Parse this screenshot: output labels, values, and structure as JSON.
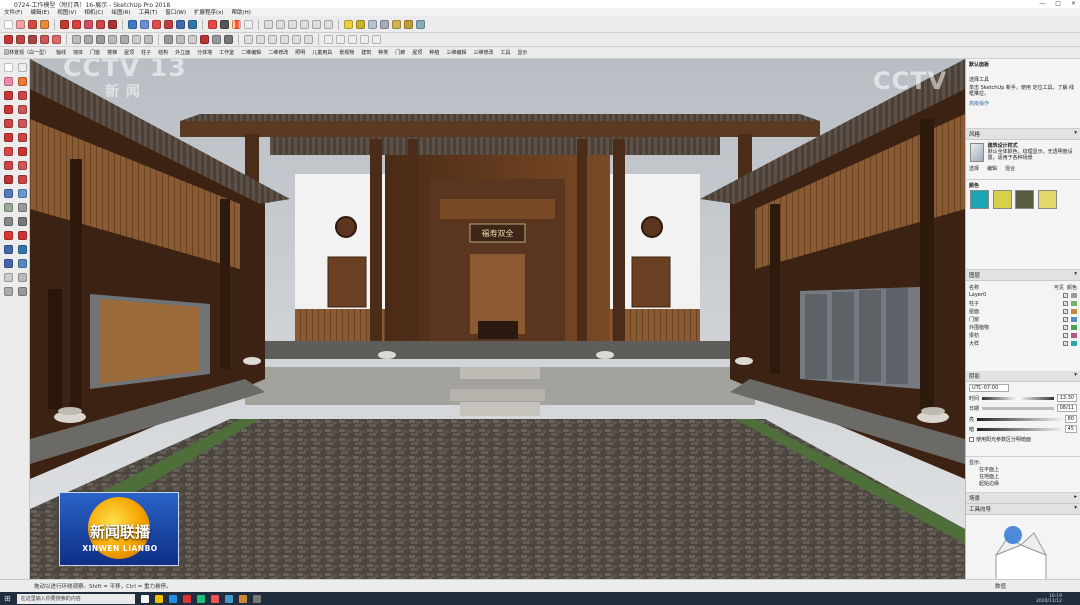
{
  "window": {
    "title": "0724-工作模型（附灯具）16-展示 - SketchUp Pro 2018",
    "controls": [
      "—",
      "□",
      "×"
    ]
  },
  "menu": [
    "文件(F)",
    "编辑(E)",
    "视图(V)",
    "相机(C)",
    "绘图(R)",
    "工具(T)",
    "窗口(W)",
    "扩展程序(x)",
    "帮助(H)"
  ],
  "plugin_toolbar": [
    "园林景观（白一型）",
    "轴线",
    "墙体",
    "门窗",
    "楼梯",
    "屋顶",
    "柱子",
    "结构",
    "外立面",
    "分体墙",
    "工作室",
    "二维编辑",
    "二维修改",
    "照明",
    "儿童用具",
    "景观物",
    "建筑",
    "种类",
    "门廊",
    "屋顶",
    "种植",
    "三维编辑",
    "三维修改",
    "工具",
    "显示"
  ],
  "watermarks": {
    "channel": "CCTV 13",
    "channel_sub": "新 闻",
    "channel_right": "CCTV"
  },
  "scene": {
    "plaque_text": "福寿双全"
  },
  "news_logo": {
    "cn": "新闻联播",
    "pinyin": "XINWEN LIANBO"
  },
  "tray": {
    "instructor_title": "默认面板",
    "instructor_tip": "选择工具",
    "instructor_note": "单击 SketchUp 新手，使用 定位工具，了解 线框推拉。",
    "instructor_link": "高级操作",
    "styles_title": "风格",
    "style_name": "建筑设计样式",
    "style_desc": "默认全体颜色，纹理显示，无透明度设置，适用于各种场景",
    "style_tabs": [
      "选择",
      "编辑",
      "混合"
    ],
    "materials_title": "颜色",
    "tags_title": "图层",
    "tags_header": [
      "名称",
      "可见",
      "颜色"
    ],
    "tags": [
      {
        "name": "Layer0",
        "color": "#9a9a9a",
        "visible": true
      },
      {
        "name": "柱子",
        "color": "#6fb36f",
        "visible": true
      },
      {
        "name": "屋面",
        "color": "#c58a46",
        "visible": true
      },
      {
        "name": "门窗",
        "color": "#4f8fc4",
        "visible": true
      },
      {
        "name": "外围植物",
        "color": "#49a64e",
        "visible": true
      },
      {
        "name": "梁枋",
        "color": "#b05a8a",
        "visible": true
      },
      {
        "name": "大样",
        "color": "#2aa6a0",
        "visible": true
      }
    ],
    "shadows_title": "阴影",
    "shadow_time_label": "时间",
    "shadow_time": "13:30",
    "shadow_date_label": "日期",
    "shadow_date": "08/11",
    "shadow_tz": "UTC-07:00",
    "light_label": "亮",
    "light_value": "80",
    "dark_label": "暗",
    "dark_value": "45",
    "sun_option": "使用阳光参数区分明暗面",
    "display_label": "显示:",
    "display_opts": [
      "在平面上",
      "在地面上",
      "起始边缘"
    ],
    "scenes_title": "场景",
    "orbit_title": "工具向导"
  },
  "status": {
    "hint": "拖动以进行环绕观察。Shift = 平移，Ctrl = 重力悬停。",
    "measure_label": "数值"
  },
  "taskbar": {
    "search": "在这里输入你要搜索的内容",
    "time": "16:19",
    "date": "2020/11/12"
  },
  "colors": {
    "chrome": "#ececec",
    "tray_bg": "#f4f4f4",
    "logo_blue": "#1a44a8",
    "wood": "#6b3e20",
    "sky": "#c9ced3"
  }
}
